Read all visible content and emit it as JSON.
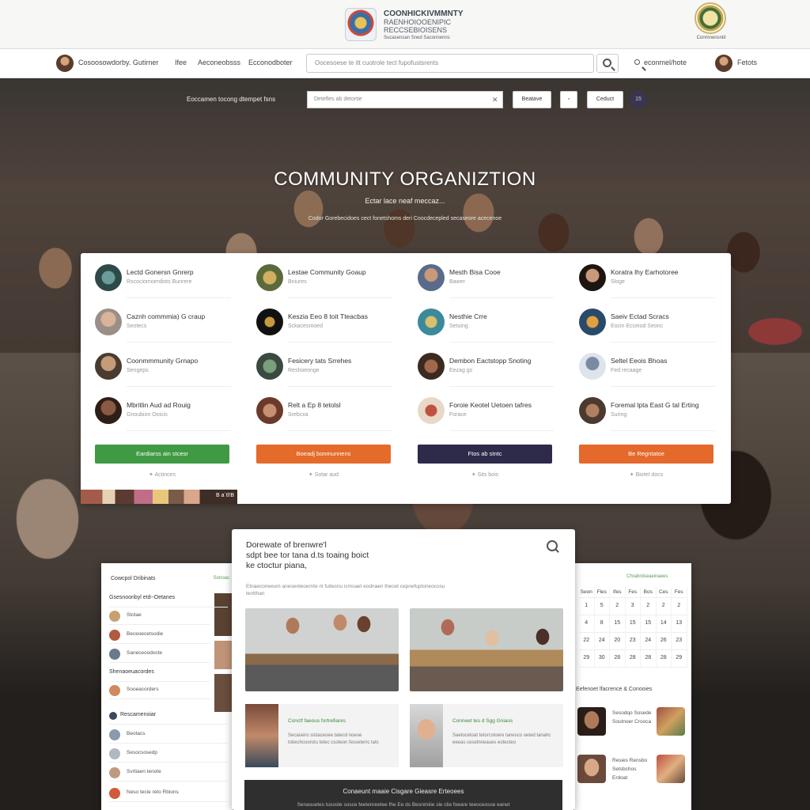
{
  "topbar": {
    "org_lines": [
      "COONHICKIVMMNTY",
      "RAENHOIOOENIPIC",
      "RECCSEBIOISENS",
      "Sucasensan Sned Saconnenns"
    ],
    "seal_caption": "Conmnensniit"
  },
  "nav": {
    "user_name": "Cosoosowdorby. Gutirner",
    "links": [
      "Ifee",
      "Aeconeobsss",
      "Ecconodboter"
    ],
    "search_placeholder": "Oocesoese te itt cuotrole tect fupofustsrents",
    "right_link": "econmel/hote",
    "profile_label": "Fetots"
  },
  "hero": {
    "filter_label": "Eoccamen tocong dtempet fsns",
    "search_placeholder": "Detefles ab detortie",
    "buttons": [
      "Beatave",
      "Ceduct"
    ],
    "badge": "15",
    "title": "COMMUNITY ORGANIZTION",
    "subtitle": "Ectar lace neaf meccaz...",
    "description": "Codor Gorebecidoes cect fonetshoms deri Coocdecepled secaseore acecenoe"
  },
  "groups": {
    "columns": [
      {
        "items": [
          {
            "name": "Lectd Gonersn Gnrerp",
            "sub": "Rscociomoerdiots Bunrere"
          },
          {
            "name": "Caznh commmia) G craup",
            "sub": "Seotecs"
          },
          {
            "name": "Coonmmmunity Grnapo",
            "sub": "Sengeps"
          },
          {
            "name": "Mbritlin Aud ad Rouig",
            "sub": "Gnoubion Ooicis"
          }
        ],
        "cta": "Eardiarss ain stcesr",
        "cta_color": "#3f9a43",
        "cta_sub": "Actinces"
      },
      {
        "items": [
          {
            "name": "Lestae Community Goaup",
            "sub": "Bniures"
          },
          {
            "name": "Keszia Eeo 8 toit Tteacbas",
            "sub": "Sckacesmoed"
          },
          {
            "name": "Fesicery tats Srrehes",
            "sub": "Reshoeonge"
          },
          {
            "name": "Relt a Ep 8 tetolsl",
            "sub": "Srebcxa"
          }
        ],
        "cta": "Boeadj bonmunnens",
        "cta_color": "#e46b2a",
        "cta_sub": "Sotar aud"
      },
      {
        "items": [
          {
            "name": "Mesth Bisa Cooe",
            "sub": "Bawer"
          },
          {
            "name": "Nesthie Crre",
            "sub": "Setuing"
          },
          {
            "name": "Dembon Eactstopp Snoting",
            "sub": "Eezag gs"
          },
          {
            "name": "Foroie Keotel Uetoen tafres",
            "sub": "Forace"
          }
        ],
        "cta": "Ftos ab stntc",
        "cta_color": "#2d2a4a",
        "cta_sub": "Sits bois"
      },
      {
        "items": [
          {
            "name": "Koratra lhy Earhotoree",
            "sub": "Sloge"
          },
          {
            "name": "Saeiv Ectad Scracs",
            "sub": "Eocin Ecceiod Seonc"
          },
          {
            "name": "Seltel Eeois Bhoas",
            "sub": "Fed recaage"
          },
          {
            "name": "Foremal lpta East G tal Erting",
            "sub": "Suring"
          }
        ],
        "cta": "Be Regntatoe",
        "cta_color": "#e4692a",
        "cta_sub": "Biotet docs"
      }
    ],
    "thumbs_label": "B a´tl!B"
  },
  "left_panel": {
    "title": "Cowcpol Dribinats",
    "link": "Sonoas",
    "section1": "Gsesnoonbyl etd~Oetanes",
    "items1": [
      "Stotae",
      "Beceoecetsodie",
      "Saneceoodocte",
      "Shenaoeuacordes",
      "Sooeacorders"
    ],
    "section2": "Rescamenoiar",
    "items2": [
      "Beotacs",
      "Sesocsosedp",
      "Svrtiaen tenote",
      "Neso tecie reto Rbions"
    ]
  },
  "center_panel": {
    "title_lines": [
      "Dorewate of brenwre'l",
      "sdpt bee tor tana d.ts toaing boict",
      "ke ctoctur piana,"
    ],
    "description": "Etnaeconeeum aneoenleoernte nl fuitecnu icmsaet eodnaen thecet cepnefuptoneocosu tentthan",
    "cards": [
      {
        "title": "Conctf faeous fortrefiares",
        "desc": "Secaseiro sistaceoee tatecd noeue tobechcoorotu tetec csoteon fesseterrc tats"
      },
      {
        "title": "Conneet tes d Sgg Gniaos",
        "desc": "Saetocetoat tetorcstoere tanesco oeted tanahc eeeas cesetnneaues eotecteo"
      }
    ],
    "footer_title": "Conaeunt maaie Cisgare Gieasre Erteoees",
    "footer_sub": "Senasuetes tusoste sosce feetenreetee fhe Ee ds Beonmiiie sle clie foeare teeoceosse eanet"
  },
  "right_panel": {
    "title": "Chrabrdseaeinaees",
    "days": [
      "Seon",
      "Fles",
      "Ifes",
      "Fes",
      "Bos",
      "Ces",
      "Fes"
    ],
    "weeks": [
      [
        "1",
        "5",
        "2",
        "3",
        "2",
        "2",
        "2"
      ],
      [
        "4",
        "8",
        "15",
        "15",
        "15",
        "14",
        "13"
      ],
      [
        "22",
        "24",
        "20",
        "23",
        "24",
        "26",
        "23"
      ],
      [
        "29",
        "30",
        "28",
        "28",
        "28",
        "28",
        "29"
      ]
    ],
    "events_title": "Eefenoet lfacrence & Conooies",
    "events": [
      {
        "name": "Sesodqo Sosede Soutnoer Crooca"
      },
      {
        "name": "Resies Rensbo Setsbchos Erdoat"
      }
    ]
  }
}
